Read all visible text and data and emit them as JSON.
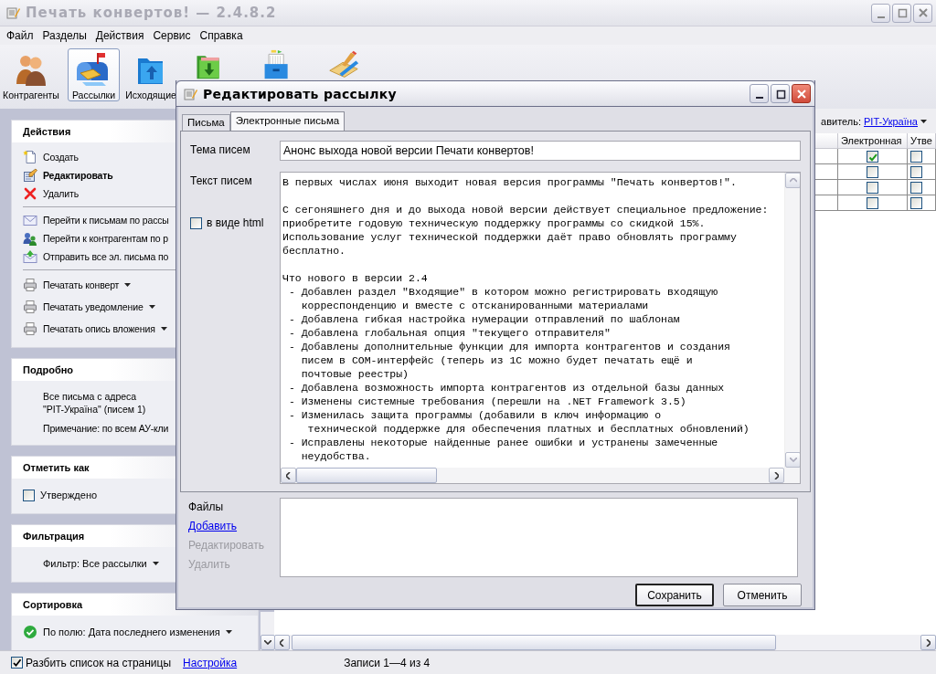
{
  "window": {
    "title": "Печать конвертов! — 2.4.8.2"
  },
  "menu": [
    "Файл",
    "Разделы",
    "Действия",
    "Сервис",
    "Справка"
  ],
  "toolbar": [
    {
      "label": "Контрагенты",
      "selected": false
    },
    {
      "label": "Рассылки",
      "selected": true
    },
    {
      "label": "Исходящие",
      "selected": false
    },
    {
      "selected": false
    },
    {
      "selected": false
    },
    {
      "selected": false
    }
  ],
  "side_panel": [
    {
      "kind": "actions",
      "title": "Действия",
      "groups": [
        [
          {
            "label": "Создать",
            "default": false,
            "dropdown": false
          },
          {
            "label": "Редактировать",
            "default": true,
            "dropdown": false
          },
          {
            "label": "Удалить",
            "default": false,
            "dropdown": false
          }
        ],
        [
          {
            "label": "Перейти к письмам по рассы",
            "default": false,
            "dropdown": false
          },
          {
            "label": "Перейти к контрагентам по р",
            "default": false,
            "dropdown": false
          },
          {
            "label": "Отправить все эл. письма по",
            "default": false,
            "dropdown": false
          }
        ],
        [
          {
            "label": "Печатать конверт",
            "default": false,
            "dropdown": true
          },
          {
            "label": "Печатать уведомление",
            "default": false,
            "dropdown": true
          },
          {
            "label": "Печатать опись вложения",
            "default": false,
            "dropdown": true
          }
        ]
      ]
    },
    {
      "kind": "details",
      "title": "Подробно",
      "lines": [
        "Все письма с адреса \"PIT-Україна\" (писем 1)",
        "Примечание: по всем АУ-кли"
      ]
    },
    {
      "kind": "checks",
      "title": "Отметить как",
      "items": [
        {
          "label": "Утверждено",
          "checked": false
        }
      ]
    },
    {
      "kind": "dropdown",
      "title": "Фильтрация",
      "value": "Фильтр: Все рассылки"
    },
    {
      "kind": "sort",
      "title": "Сортировка",
      "value": "По полю: Дата последнего изменения"
    }
  ],
  "grid": {
    "sender_label": "авитель:",
    "sender": "PIT-Україна",
    "columns": [
      "Электронная",
      "Утве"
    ],
    "rows": [
      {
        "electronic": true,
        "approved": false
      },
      {
        "electronic": false,
        "approved": false
      },
      {
        "electronic": false,
        "approved": false
      },
      {
        "electronic": false,
        "approved": false
      }
    ]
  },
  "status_bar": {
    "paginate": {
      "label": "Разбить список на страницы",
      "checked": true
    },
    "settings_link": "Настройка",
    "records": "Записи 1—4 из 4"
  },
  "dialog": {
    "title": "Редактировать рассылку",
    "tabs": [
      {
        "label": "Письма",
        "selected": false
      },
      {
        "label": "Электронные письма",
        "selected": true
      }
    ],
    "subject": {
      "label": "Тема писем",
      "value": "Анонс выхода новой версии Печати конвертов!"
    },
    "body": {
      "label": "Текст писем",
      "value": "В первых числах июня выходит новая версия программы \"Печать конвертов!\".\n\nС сегоняшнего дня и до выхода новой версии действует специальное предложение:\nприобретите годовую техническую поддержку программы со скидкой 15%.\nИспользование услуг технической поддержки даёт право обновлять программу\nбесплатно.\n\nЧто нового в версии 2.4\n - Добавлен раздел \"Входящие\" в котором можно регистрировать входящую\n   корреспонденцию и вместе с отсканированными материалами\n - Добавлена гибкая настройка нумерации отправлений по шаблонам\n - Добавлена глобальная опция \"текущего отправителя\"\n - Добавлены дополнительные функции для импорта контрагентов и создания\n   писем в COM-интерфейс (теперь из 1С можно будет печатать ещё и\n   почтовые реестры)\n - Добавлена возможность импорта контрагентов из отдельной базы данных\n - Изменены системные требования (перешли на .NET Framework 3.5)\n - Изменилась защита программы (добавили в ключ информацию о\n    технической поддержке для обеспечения платных и бесплатных обновлений)\n - Исправлены некоторые найденные ранее ошибки и устранены замеченные\n   неудобства."
    },
    "html": {
      "label": "в виде html",
      "checked": false
    },
    "files": {
      "label": "Файлы",
      "actions": [
        {
          "label": "Добавить",
          "disabled": false
        },
        {
          "label": "Редактировать",
          "disabled": true
        },
        {
          "label": "Удалить",
          "disabled": true
        }
      ]
    },
    "buttons": [
      {
        "label": "Сохранить",
        "default": true
      },
      {
        "label": "Отменить",
        "default": false
      }
    ]
  }
}
